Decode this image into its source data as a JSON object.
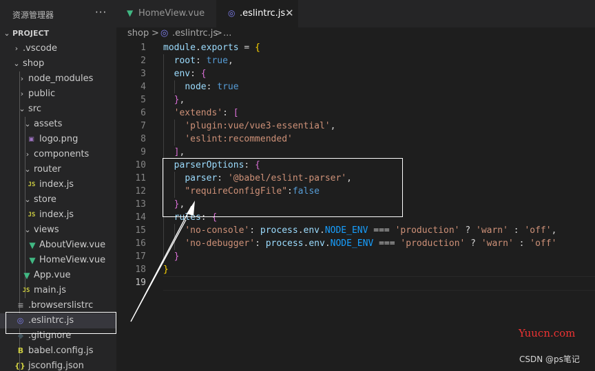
{
  "sidebar": {
    "title": "资源管理器",
    "more": "···",
    "project": "PROJECT",
    "items": [
      {
        "label": ".vscode",
        "icon": "chevron-right-icon"
      },
      {
        "label": "shop",
        "icon": "chevron-down-icon"
      },
      {
        "label": "node_modules",
        "icon": "chevron-right-icon"
      },
      {
        "label": "public",
        "icon": "chevron-right-icon"
      },
      {
        "label": "src",
        "icon": "chevron-down-icon"
      },
      {
        "label": "assets",
        "icon": "chevron-down-icon"
      },
      {
        "label": "logo.png",
        "icon": "image-icon"
      },
      {
        "label": "components",
        "icon": "chevron-right-icon"
      },
      {
        "label": "router",
        "icon": "chevron-down-icon"
      },
      {
        "label": "index.js",
        "icon": "js-file-icon"
      },
      {
        "label": "store",
        "icon": "chevron-down-icon"
      },
      {
        "label": "index.js",
        "icon": "js-file-icon"
      },
      {
        "label": "views",
        "icon": "chevron-down-icon"
      },
      {
        "label": "AboutView.vue",
        "icon": "vue-file-icon"
      },
      {
        "label": "HomeView.vue",
        "icon": "vue-file-icon"
      },
      {
        "label": "App.vue",
        "icon": "vue-file-icon"
      },
      {
        "label": "main.js",
        "icon": "js-file-icon"
      },
      {
        "label": ".browserslistrc",
        "icon": "list-file-icon"
      },
      {
        "label": ".eslintrc.js",
        "icon": "eslint-file-icon"
      },
      {
        "label": ".gitignore",
        "icon": "git-file-icon"
      },
      {
        "label": "babel.config.js",
        "icon": "babel-file-icon"
      },
      {
        "label": "jsconfig.json",
        "icon": "json-file-icon"
      }
    ]
  },
  "tabs": [
    {
      "label": "HomeView.vue",
      "icon": "vue-file-icon",
      "active": false
    },
    {
      "label": ".eslintrc.js",
      "icon": "eslint-file-icon",
      "active": true,
      "close": "✕"
    }
  ],
  "breadcrumb": {
    "folder": "shop",
    "sep": ">",
    "file": ".eslintrc.js",
    "more": "..."
  },
  "editor": {
    "line_numbers": [
      "1",
      "2",
      "3",
      "4",
      "5",
      "6",
      "7",
      "8",
      "9",
      "10",
      "11",
      "12",
      "13",
      "14",
      "15",
      "16",
      "17",
      "18",
      "19"
    ],
    "current_line": 19
  },
  "watermarks": {
    "site": "Yuucn.com",
    "credit": "CSDN @ps笔记"
  },
  "colors": {
    "accent_tab": "#1e1e1e",
    "vue": "#41b883",
    "js": "#cbcb41",
    "eslint": "#8080f2"
  }
}
